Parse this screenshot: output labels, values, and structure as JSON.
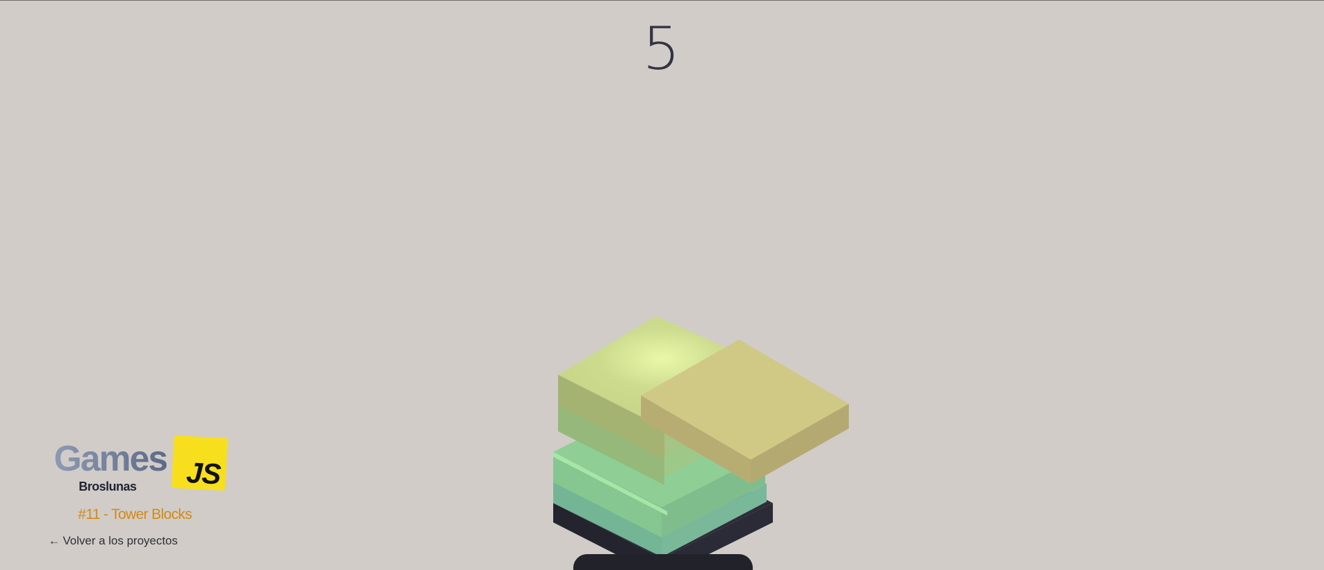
{
  "game": {
    "score": "5"
  },
  "brand": {
    "games_label": "Games",
    "js_label": "JS",
    "author": "Broslunas"
  },
  "project": {
    "title": "#11 - Tower Blocks"
  },
  "navigation": {
    "back_arrow": "←",
    "back_label": "Volver a los proyectos"
  },
  "colors": {
    "background": "#d1ccc8",
    "score": "#333344",
    "accent_title": "#d28a13",
    "js_badge": "#f7df1e",
    "base_block": "#22222a"
  },
  "icons": [
    "back-arrow-icon",
    "js-logo-icon"
  ]
}
